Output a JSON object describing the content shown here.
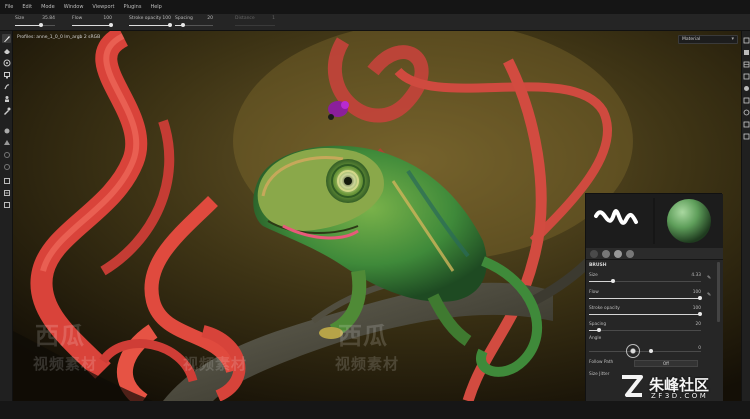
{
  "menu": [
    "File",
    "Edit",
    "Mode",
    "Window",
    "Viewport",
    "Plugins",
    "Help"
  ],
  "toolbar": {
    "size": {
      "label": "Size",
      "value": "35.84"
    },
    "flow": {
      "label": "Flow",
      "value": "100"
    },
    "stroke_opacity": {
      "label": "Stroke opacity",
      "value": "100"
    },
    "spacing": {
      "label": "Spacing",
      "value": "20"
    },
    "distance": {
      "label": "Distance",
      "value": "1"
    }
  },
  "viewport": {
    "label": "Profiles: anne_1_0_0 lm_argb 2 sRGB",
    "material_select": "Material"
  },
  "brush_panel": {
    "section": "BRUSH",
    "size": {
      "label": "Size",
      "value": "4.33"
    },
    "flow": {
      "label": "Flow",
      "value": "100"
    },
    "stroke_opacity": {
      "label": "Stroke opacity",
      "value": "100"
    },
    "spacing": {
      "label": "Spacing",
      "value": "20"
    },
    "angle": {
      "label": "Angle",
      "value": "0"
    },
    "follow_path": {
      "label": "Follow Path",
      "value": "Off"
    },
    "size_jitter": {
      "label": "Size Jitter"
    }
  },
  "watermarks": {
    "line1": "西瓜",
    "line2": "视频素材"
  },
  "brand": {
    "name": "朱峰社区",
    "site": "ZF3D.COM"
  },
  "colors": {
    "ribbon": "#d9433a",
    "chameleon": "#3f8a3a",
    "background": "#3a2f14",
    "panel": "#222222"
  }
}
